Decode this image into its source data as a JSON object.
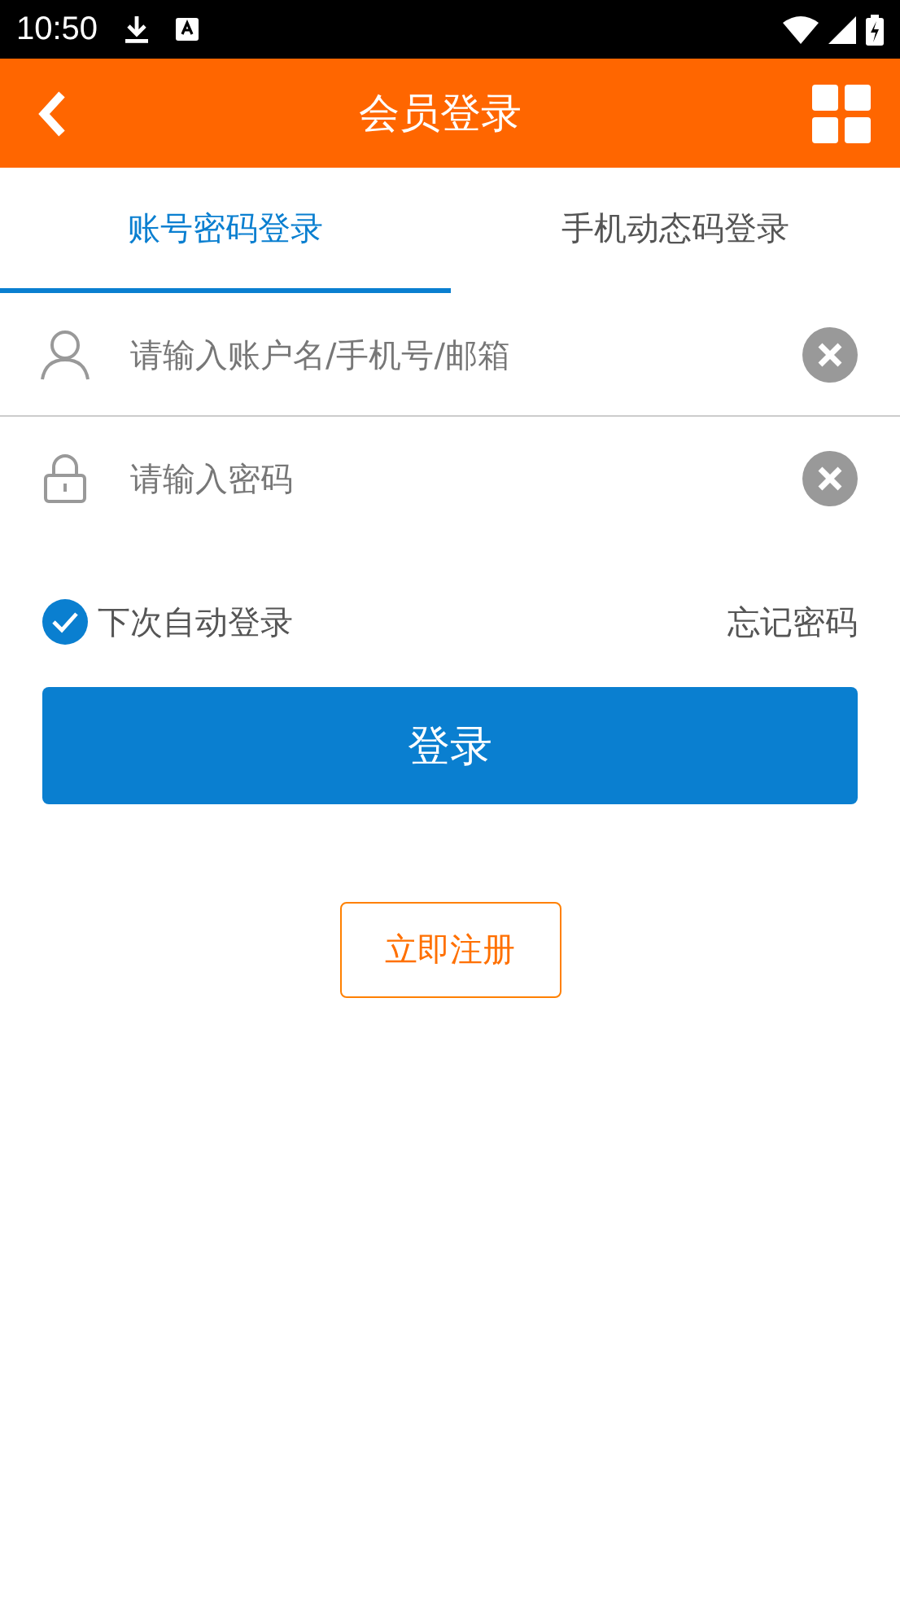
{
  "status_bar": {
    "time": "10:50"
  },
  "header": {
    "title": "会员登录"
  },
  "tabs": [
    {
      "label": "账号密码登录",
      "selected": true
    },
    {
      "label": "手机动态码登录",
      "selected": false
    }
  ],
  "fields": [
    {
      "kind": "user",
      "placeholder": "请输入账户名/手机号/邮箱"
    },
    {
      "kind": "lock",
      "placeholder": "请输入密码"
    }
  ],
  "remember": {
    "label": "下次自动登录",
    "checked": true
  },
  "forgot_link": "忘记密码",
  "login_button": "登录",
  "register_button": "立即注册"
}
